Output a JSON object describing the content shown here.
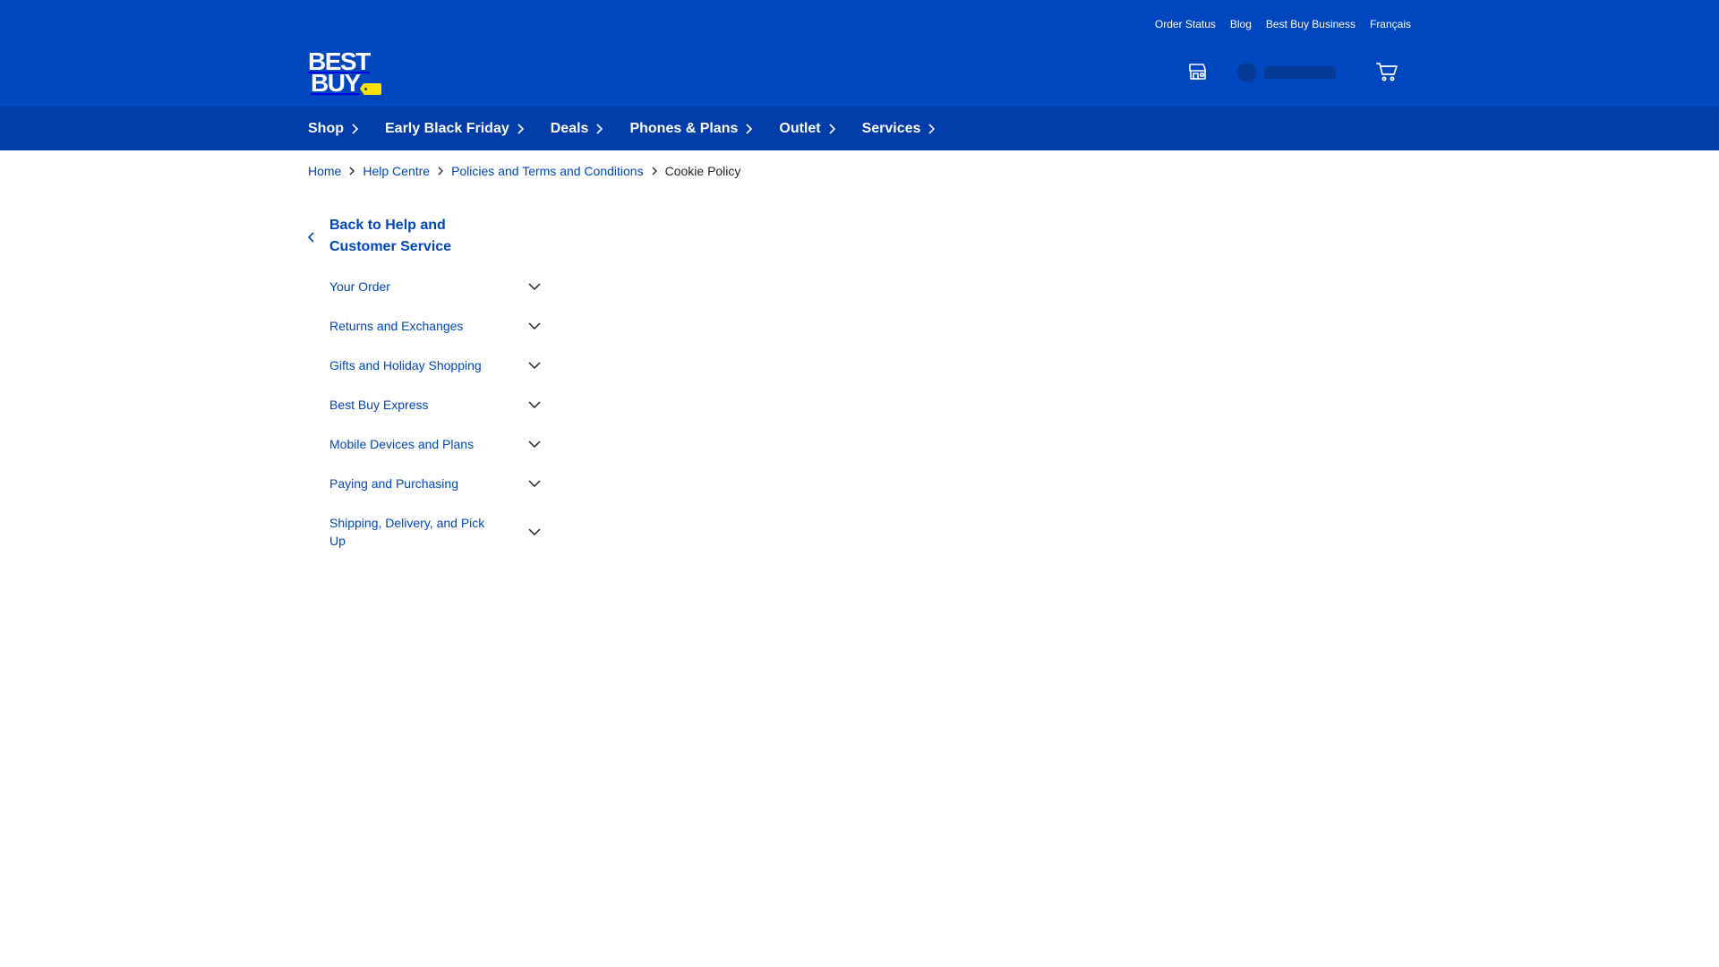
{
  "utility_nav": [
    {
      "label": "Order Status"
    },
    {
      "label": "Blog"
    },
    {
      "label": "Best Buy Business"
    },
    {
      "label": "Français"
    }
  ],
  "logo": {
    "line1": "BEST",
    "line2": "BUY",
    "tag_color": "#ffe000"
  },
  "header_icons": [
    "store-icon",
    "account-avatar",
    "cart-icon"
  ],
  "nav": [
    {
      "label": "Shop"
    },
    {
      "label": "Early Black Friday"
    },
    {
      "label": "Deals"
    },
    {
      "label": "Phones & Plans"
    },
    {
      "label": "Outlet"
    },
    {
      "label": "Services"
    }
  ],
  "breadcrumb": {
    "items": [
      {
        "label": "Home"
      },
      {
        "label": "Help Centre"
      },
      {
        "label": "Policies and Terms and Conditions"
      }
    ],
    "current": "Cookie Policy"
  },
  "sidebar": {
    "back_label": "Back to Help and Customer Service",
    "items": [
      {
        "label": "Your Order"
      },
      {
        "label": "Returns and Exchanges"
      },
      {
        "label": "Gifts and Holiday Shopping"
      },
      {
        "label": "Best Buy Express"
      },
      {
        "label": "Mobile Devices and Plans"
      },
      {
        "label": "Paying and Purchasing"
      },
      {
        "label": "Shipping, Delivery, and Pick Up"
      }
    ]
  },
  "colors": {
    "header_bg": "#0046be",
    "nav_bg": "#003da8",
    "link": "#0046be",
    "text": "#1d252c",
    "accent_yellow": "#ffe000"
  }
}
